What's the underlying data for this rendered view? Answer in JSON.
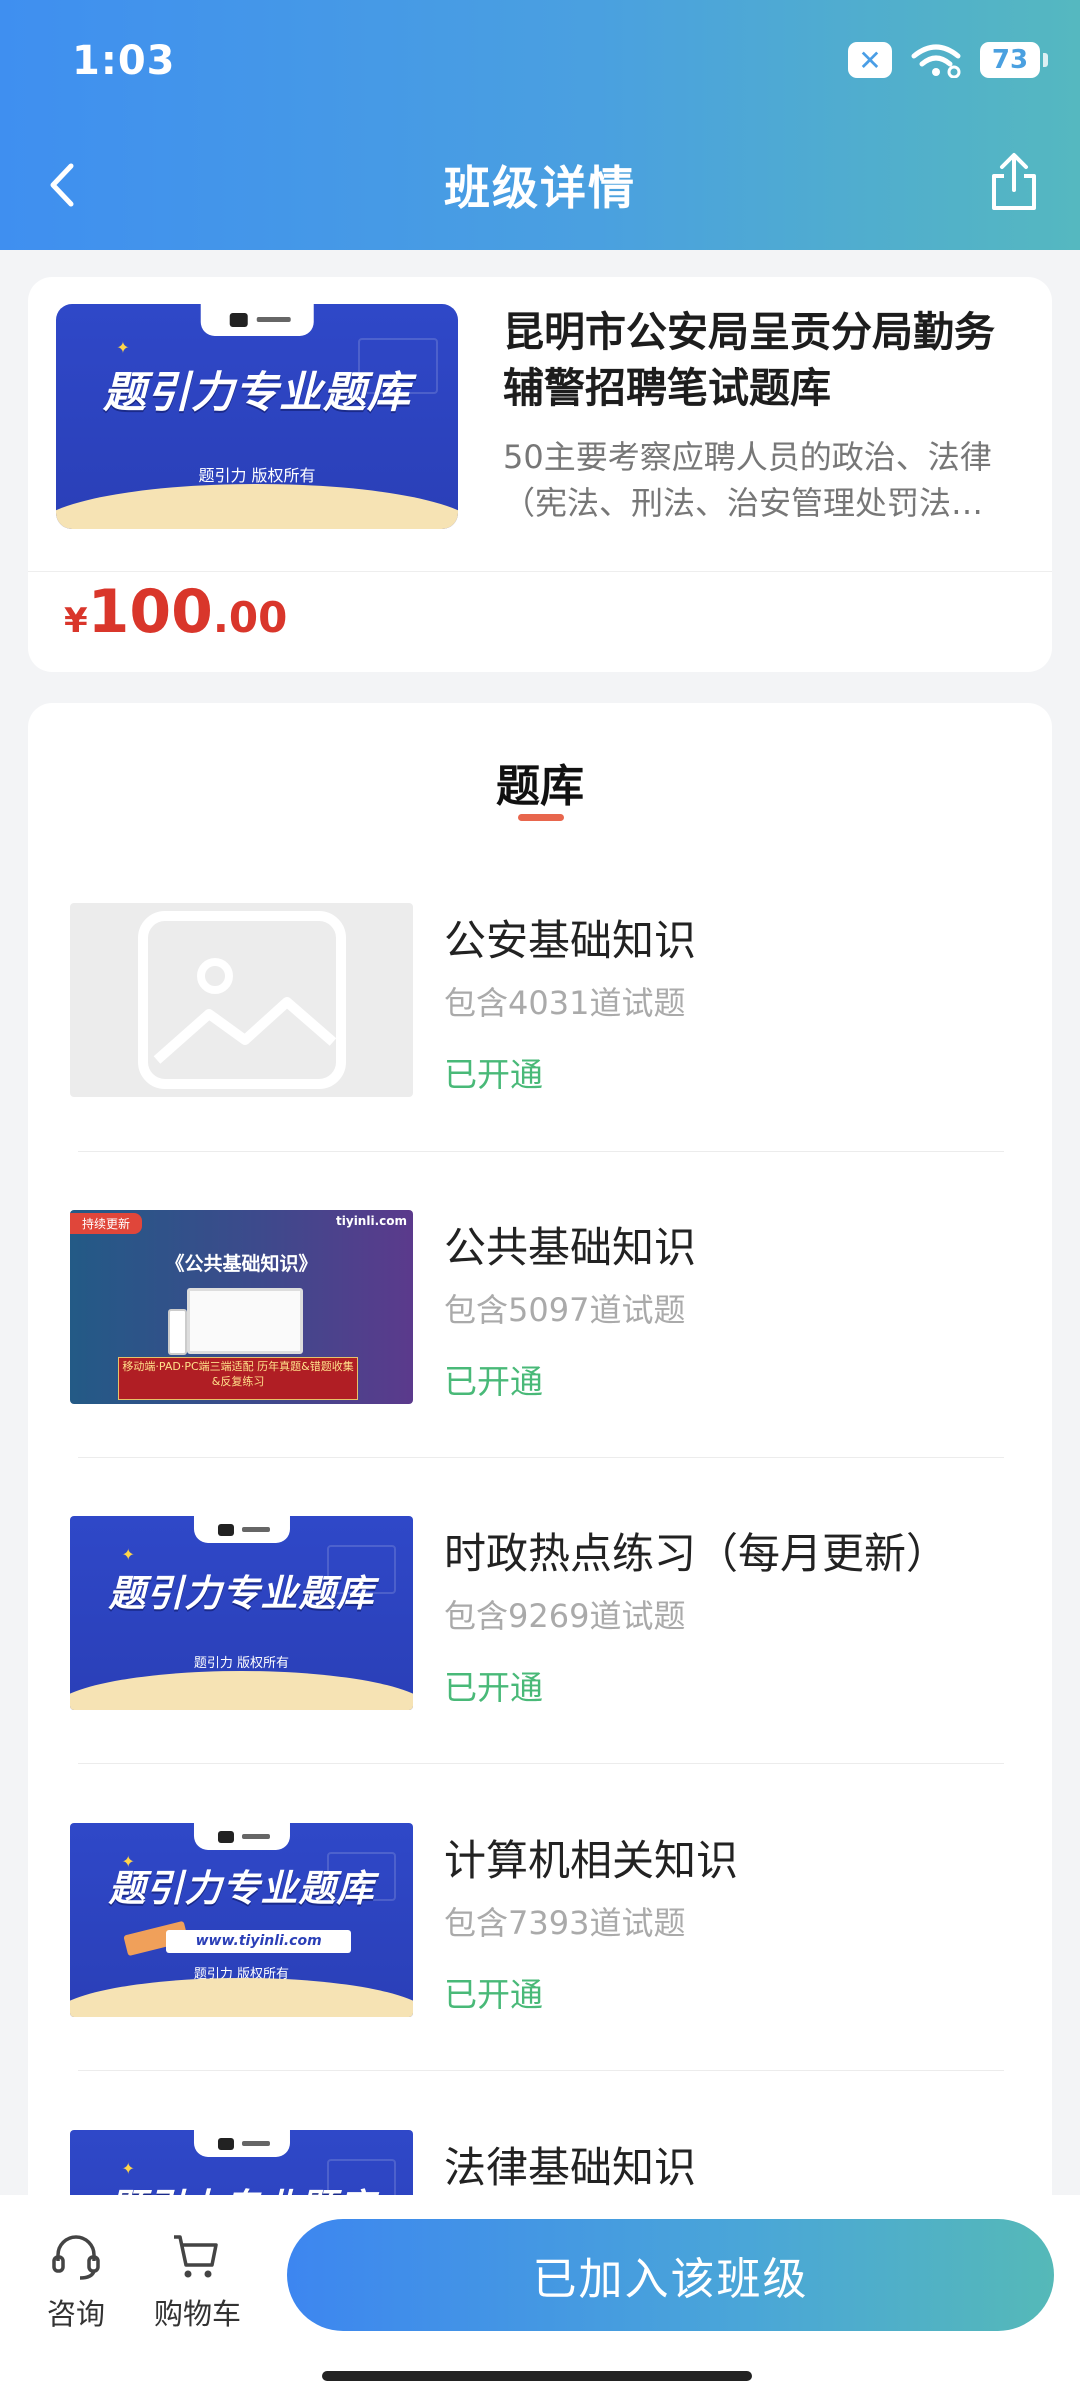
{
  "status_bar": {
    "time": "1:03",
    "battery": "73"
  },
  "header": {
    "title": "班级详情"
  },
  "class_card": {
    "cover": {
      "headline": "题引力专业题库",
      "sub": "题引力 版权所有"
    },
    "title": "昆明市公安局呈贡分局勤务辅警招聘笔试题库",
    "description": "50主要考察应聘人员的政治、法律（宪法、刑法、治安管理处罚法…",
    "price": {
      "currency": "¥",
      "integer": "100",
      "decimal": ".00"
    }
  },
  "section": {
    "title": "题库"
  },
  "banks": [
    {
      "name": "公安基础知识",
      "count": "包含4031道试题",
      "status": "已开通",
      "thumb": "placeholder-image-icon"
    },
    {
      "name": "公共基础知识",
      "count": "包含5097道试题",
      "status": "已开通",
      "thumb": "promo-public",
      "promo": {
        "ribbon": "持续更新",
        "logo": "tiyinli.com",
        "title": "《公共基础知识》",
        "banner": "移动端·PAD·PC端三端适配 历年真题&错题收集&反复练习"
      }
    },
    {
      "name": "时政热点练习（每月更新）",
      "count": "包含9269道试题",
      "status": "已开通",
      "thumb": "promo",
      "promo": {
        "headline": "题引力专业题库",
        "sub": "题引力 版权所有"
      }
    },
    {
      "name": "计算机相关知识",
      "count": "包含7393道试题",
      "status": "已开通",
      "thumb": "promo-url",
      "promo": {
        "headline": "题引力专业题库",
        "url": "www.tiyinli.com",
        "sub": "题引力 版权所有"
      }
    },
    {
      "name": "法律基础知识",
      "thumb": "promo",
      "promo": {
        "headline": "题引力专业题库"
      }
    }
  ],
  "bottom_bar": {
    "consult": "咨询",
    "cart": "购物车",
    "join": "已加入该班级"
  },
  "colors": {
    "accent": "#3f8ff0",
    "price": "#d9362b",
    "status_open": "#49b978",
    "tab_underline": "#e8664d"
  }
}
